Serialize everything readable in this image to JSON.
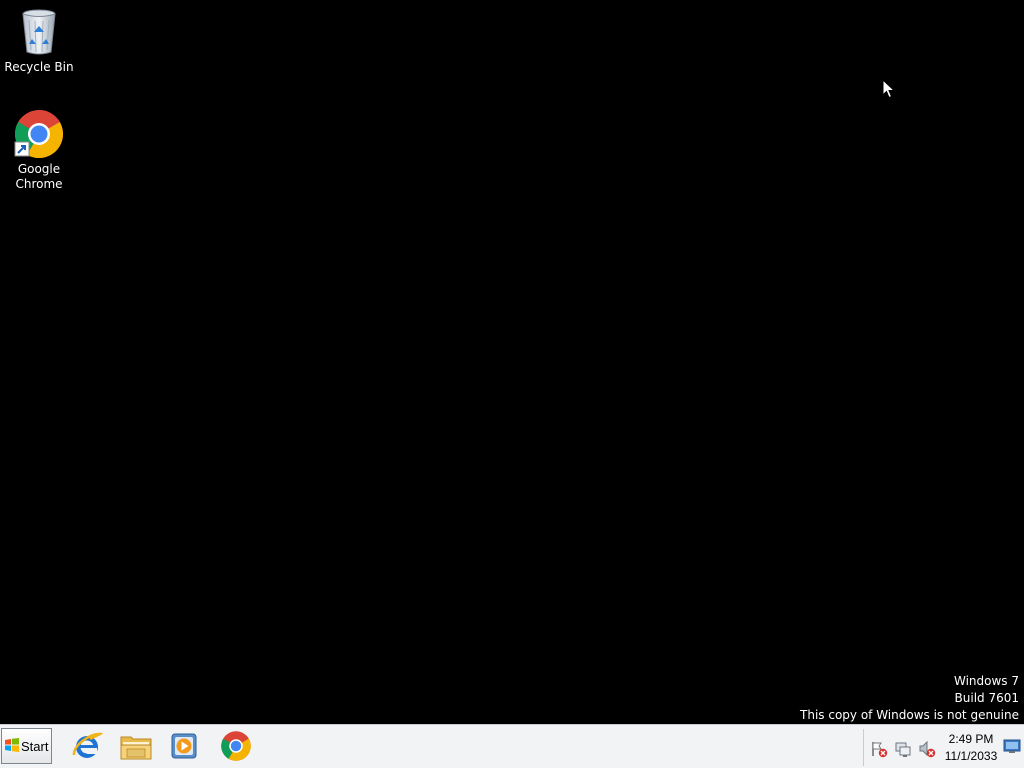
{
  "desktop": {
    "icons": [
      {
        "label": "Recycle Bin",
        "icon": "recycle-bin-icon"
      },
      {
        "label_line1": "Google",
        "label_line2": "Chrome",
        "icon": "chrome-icon"
      }
    ],
    "watermark": {
      "line1": "Windows 7",
      "line2": "Build 7601",
      "line3": "This copy of Windows is not genuine"
    }
  },
  "taskbar": {
    "start_label": "Start",
    "pinned": [
      {
        "name": "Internet Explorer",
        "icon": "internet-explorer-icon"
      },
      {
        "name": "Windows Explorer",
        "icon": "folder-icon"
      },
      {
        "name": "Windows Media Player",
        "icon": "media-player-icon"
      },
      {
        "name": "Google Chrome",
        "icon": "chrome-icon"
      }
    ],
    "tray": {
      "icons": [
        "action-center-flag-icon",
        "network-icon",
        "volume-icon"
      ]
    },
    "clock": {
      "time": "2:49 PM",
      "date": "11/1/2033"
    }
  },
  "colors": {
    "desktop_background": "#000000",
    "taskbar_background": "#f2f3f4",
    "chrome_red": "#db4437",
    "chrome_green": "#0f9d58",
    "chrome_yellow": "#f4b400",
    "chrome_blue": "#4285f4"
  }
}
